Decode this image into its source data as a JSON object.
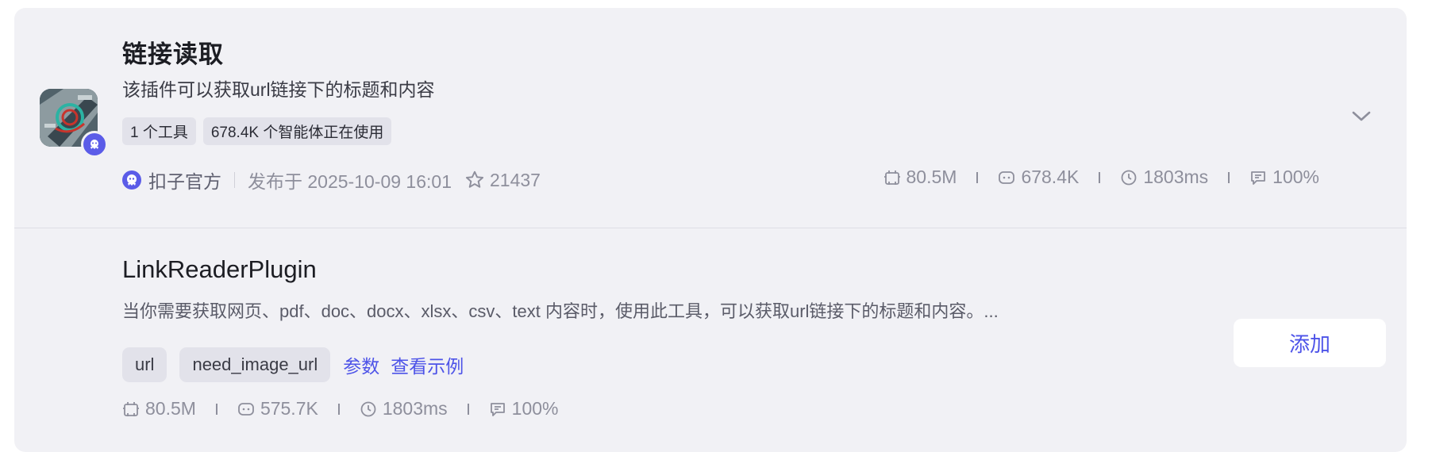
{
  "plugin": {
    "title": "链接读取",
    "description": "该插件可以获取url链接下的标题和内容",
    "tags": [
      "1 个工具",
      "678.4K 个智能体正在使用"
    ],
    "author": "扣子官方",
    "published": "发布于 2025-10-09 16:01",
    "stars": "21437",
    "stats": {
      "size": "80.5M",
      "bots": "678.4K",
      "latency": "1803ms",
      "success": "100%"
    },
    "icons": {
      "avatar": "plugin-avatar-image",
      "badge": "coze-badge-icon",
      "author": "coze-official-icon",
      "star": "star-icon",
      "size": "storage-icon",
      "bots": "bot-icon",
      "latency": "clock-icon",
      "success": "success-rate-icon",
      "expand": "chevron-down-icon"
    }
  },
  "tool": {
    "title": "LinkReaderPlugin",
    "description": "当你需要获取网页、pdf、doc、docx、xlsx、csv、text 内容时，使用此工具，可以获取url链接下的标题和内容。...",
    "params": [
      "url",
      "need_image_url"
    ],
    "links": {
      "params": "参数",
      "example": "查看示例"
    },
    "stats": {
      "size": "80.5M",
      "bots": "575.7K",
      "latency": "1803ms",
      "success": "100%"
    },
    "add_label": "添加"
  },
  "colors": {
    "accent": "#4d53e8",
    "card_bg": "#f1f1f5",
    "muted": "#8e8f9c"
  }
}
